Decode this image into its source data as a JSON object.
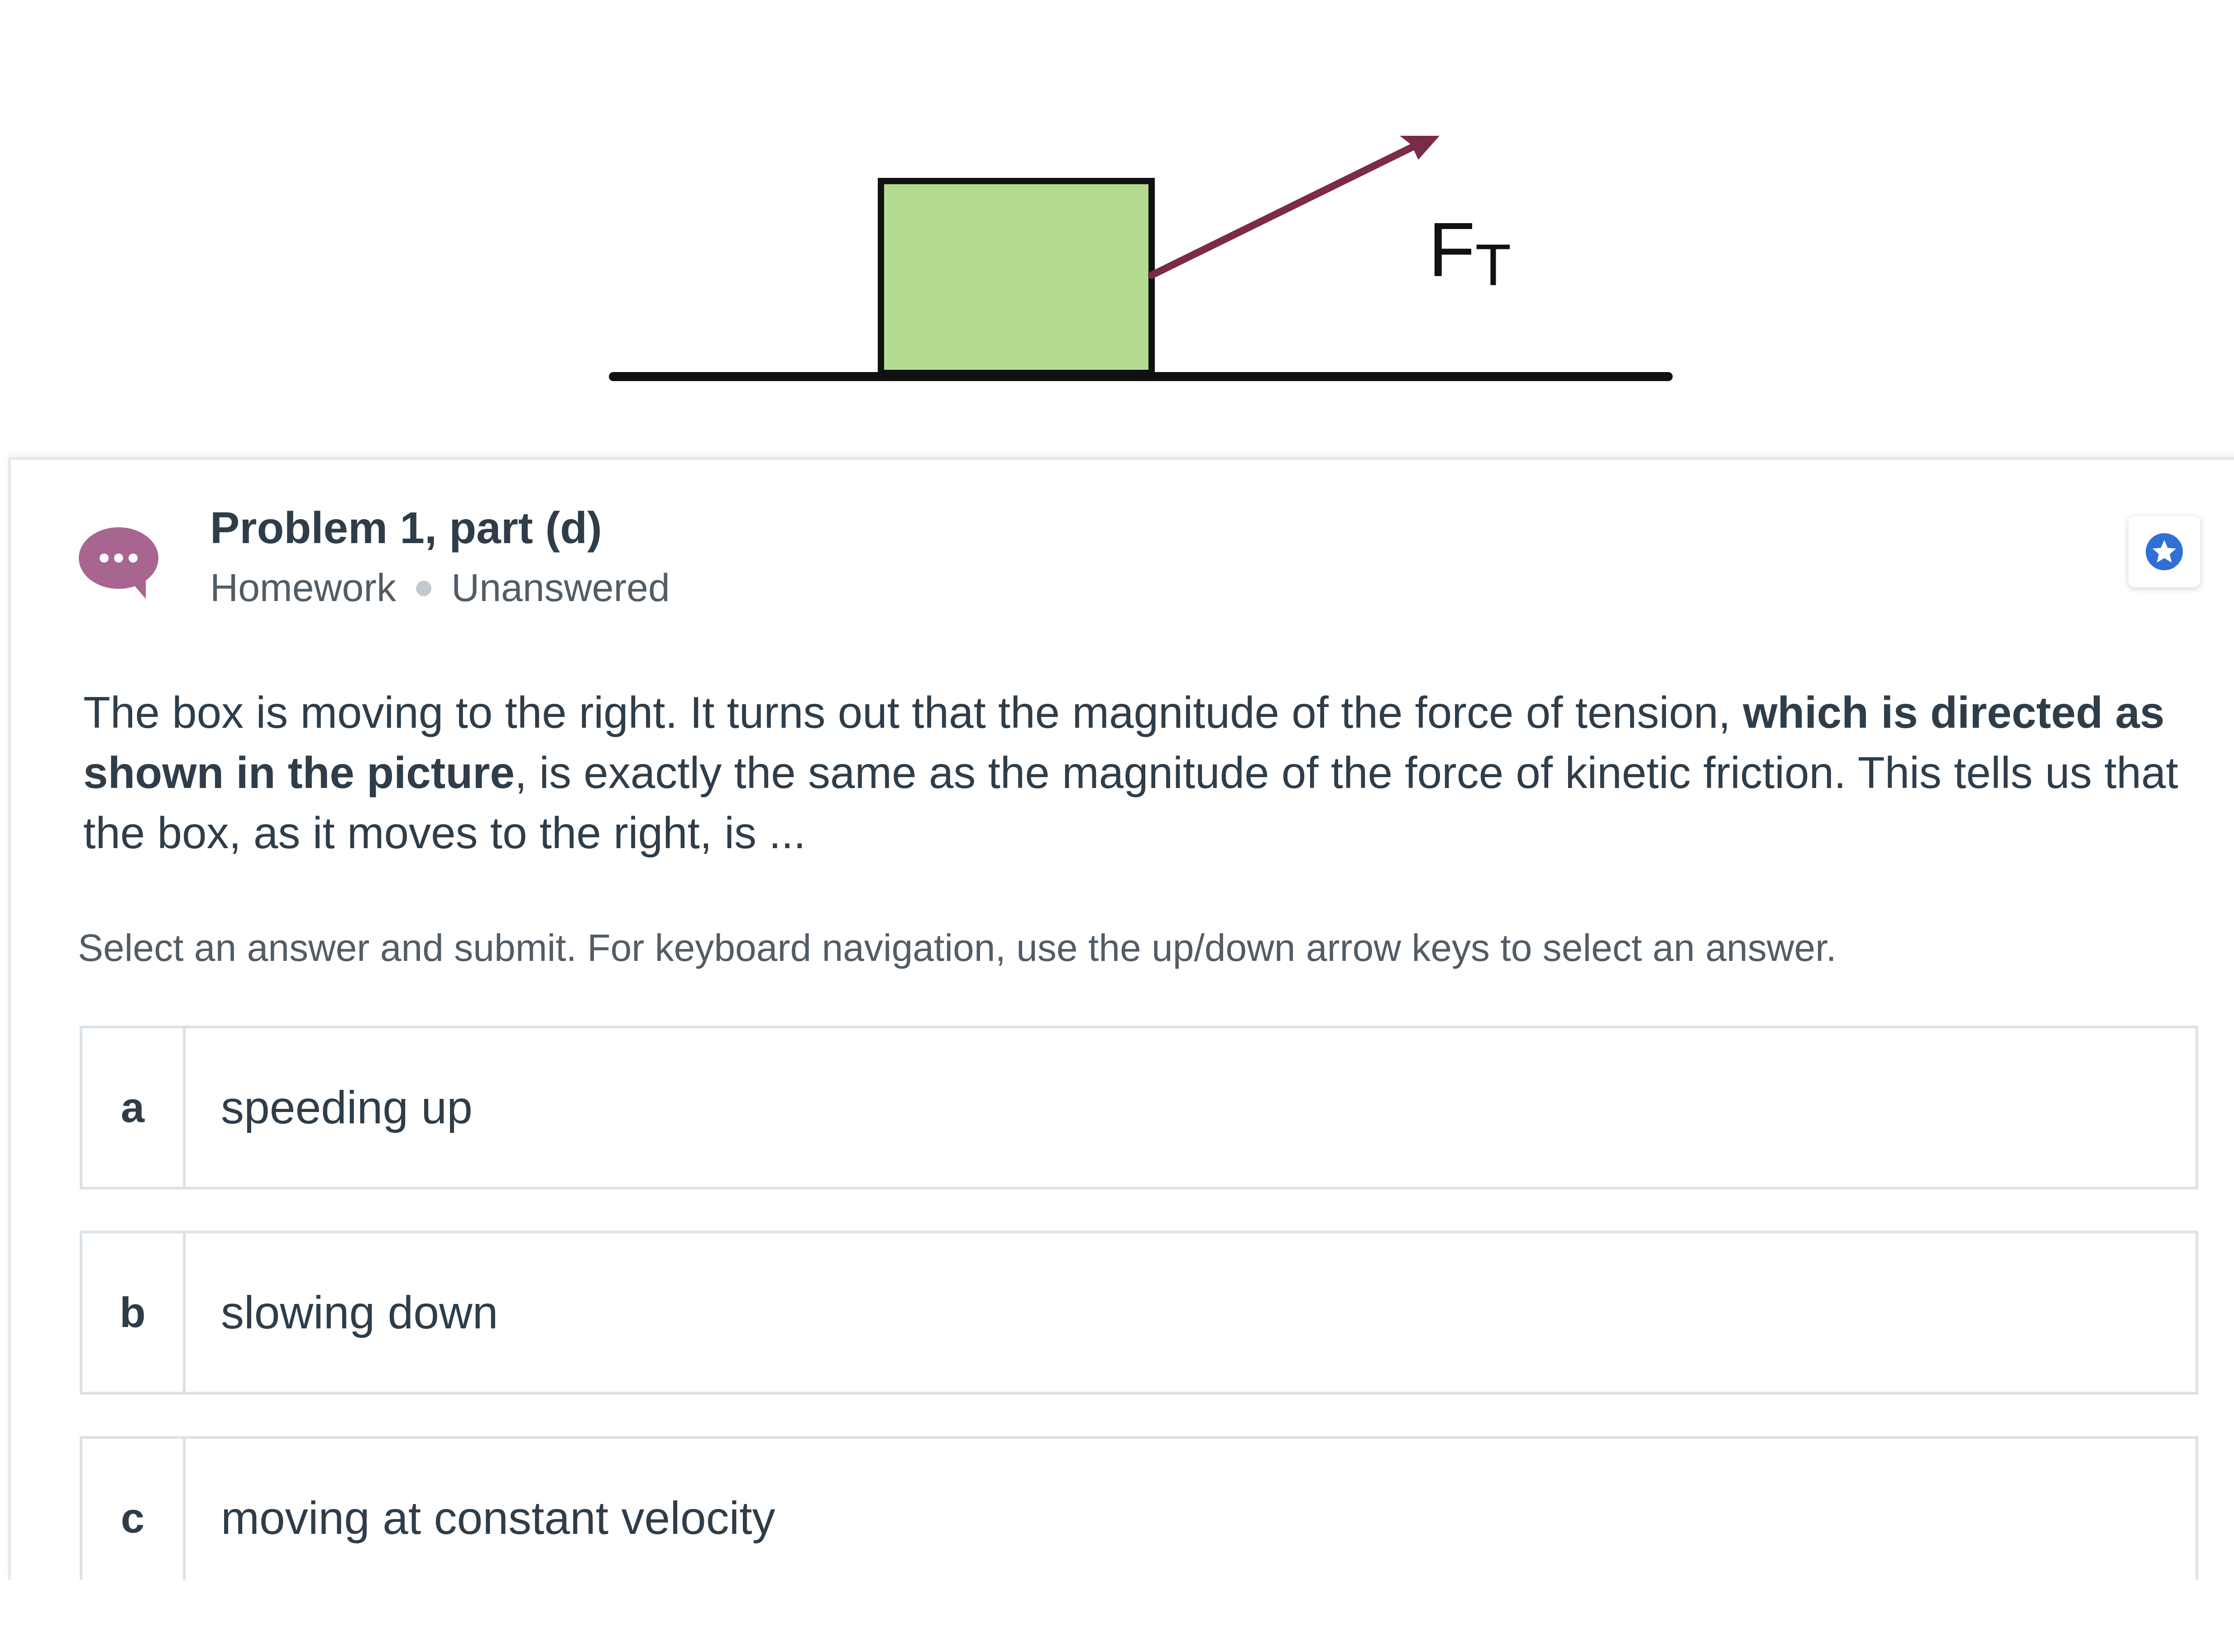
{
  "figure": {
    "force_label": "F",
    "force_subscript": "T",
    "colors": {
      "box_fill": "#b3dc90",
      "arrow": "#7b2a49",
      "ground": "#111111"
    }
  },
  "problem": {
    "title": "Problem 1, part (d)",
    "category": "Homework",
    "status": "Unanswered",
    "avatar_icon": "speech-bubble-ellipsis-icon",
    "bookmark_icon": "star-badge-icon",
    "colors": {
      "avatar": "#a8658f",
      "bookmark": "#2f6fd6"
    }
  },
  "question": {
    "text_part1": "The box is moving to the right. It turns out that the magnitude of the force of tension, ",
    "text_bold": "which is directed as shown in the picture",
    "text_part2": ", is exactly the same as the magnitude of the force of kinetic friction. This tells us that the box, as it moves to the right, is ..."
  },
  "instructions": "Select an answer and submit. For keyboard navigation, use the up/down arrow keys to select an answer.",
  "answers": [
    {
      "letter": "a",
      "text": "speeding up"
    },
    {
      "letter": "b",
      "text": "slowing down"
    },
    {
      "letter": "c",
      "text": "moving at constant velocity"
    }
  ]
}
